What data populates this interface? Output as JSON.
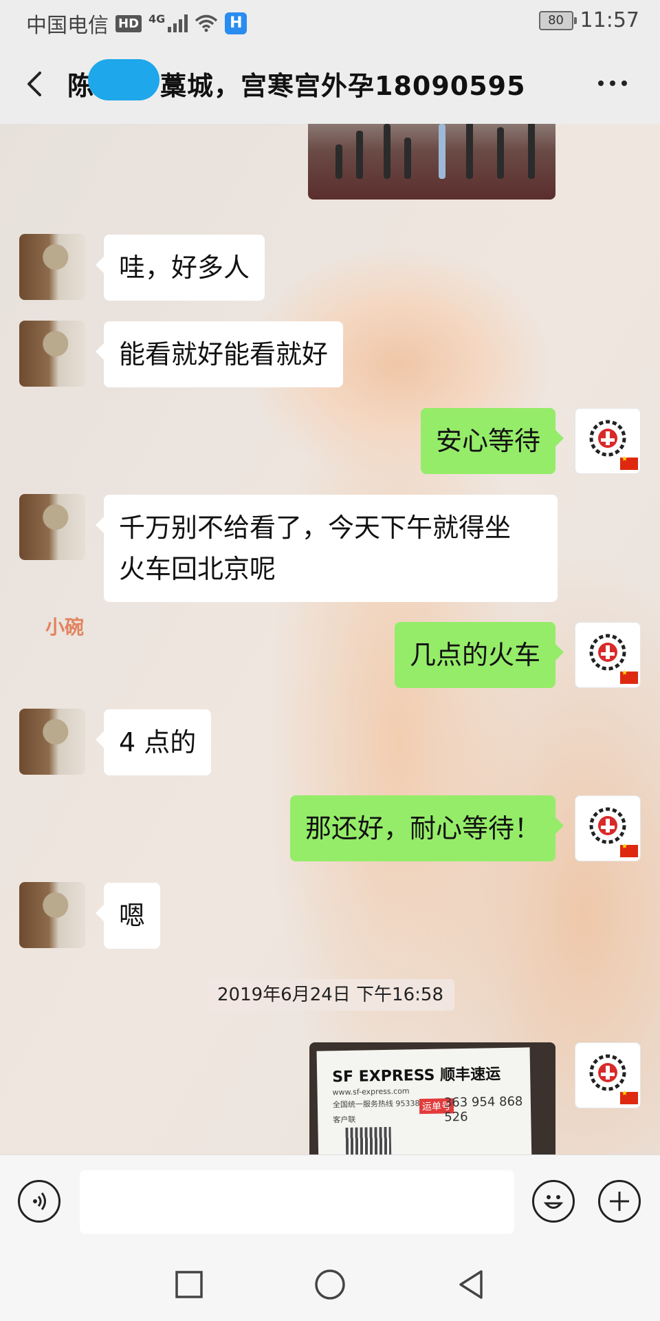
{
  "status_bar": {
    "carrier": "中国电信",
    "hd": "HD",
    "network": "4G",
    "hi_badge": "H",
    "battery": "80",
    "time": "11:57"
  },
  "header": {
    "title_prefix": "陈",
    "title_suffix": "藁城，宫寒宫外孕18090595"
  },
  "watermark": "小碗",
  "messages": [
    {
      "side": "left",
      "text": "哇，好多人"
    },
    {
      "side": "left",
      "text": "能看就好能看就好"
    },
    {
      "side": "right",
      "text": "安心等待"
    },
    {
      "side": "left",
      "text": "千万别不给看了，今天下午就得坐\n火车回北京呢"
    },
    {
      "side": "right",
      "text": "几点的火车"
    },
    {
      "side": "left",
      "text": "4 点的"
    },
    {
      "side": "right",
      "text": "那还好，耐心等待！"
    },
    {
      "side": "left",
      "text": "嗯"
    }
  ],
  "timestamp": "2019年6月24日 下午16:58",
  "sf_photo": {
    "logo": "SF EXPRESS 顺丰速运",
    "url": "www.sf-express.com",
    "hotline": "全国统一服务热线 95338",
    "tracking_tag": "运单号",
    "tracking_number": "363 954 868 526",
    "copy_label": "客户联"
  },
  "input": {
    "placeholder": ""
  },
  "colors": {
    "sent_bubble": "#95ec69",
    "received_bubble": "#ffffff",
    "bar_bg": "#ededed",
    "redaction": "#1ea7ea"
  },
  "icons": {
    "back": "chevron-left-icon",
    "more": "more-dots-icon",
    "voice": "voice-icon",
    "emoji": "emoji-icon",
    "plus": "plus-icon",
    "nav_recents": "square-icon",
    "nav_home": "circle-icon",
    "nav_back": "triangle-back-icon"
  }
}
